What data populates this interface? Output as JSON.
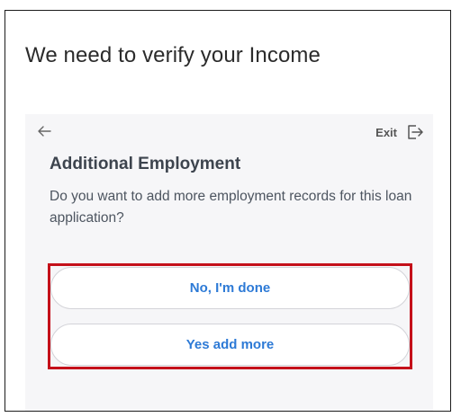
{
  "page": {
    "title": "We need to verify your Income"
  },
  "card": {
    "back_icon": "arrow-left-icon",
    "exit_label": "Exit",
    "exit_icon": "exit-door-icon",
    "heading": "Additional Employment",
    "description": "Do you want to add more employment records for this loan application?",
    "options": [
      {
        "label": "No, I'm done"
      },
      {
        "label": "Yes add more"
      }
    ]
  },
  "colors": {
    "highlight_border": "#c4101a",
    "button_text": "#2d7ad6",
    "card_background": "#f6f6f8"
  }
}
